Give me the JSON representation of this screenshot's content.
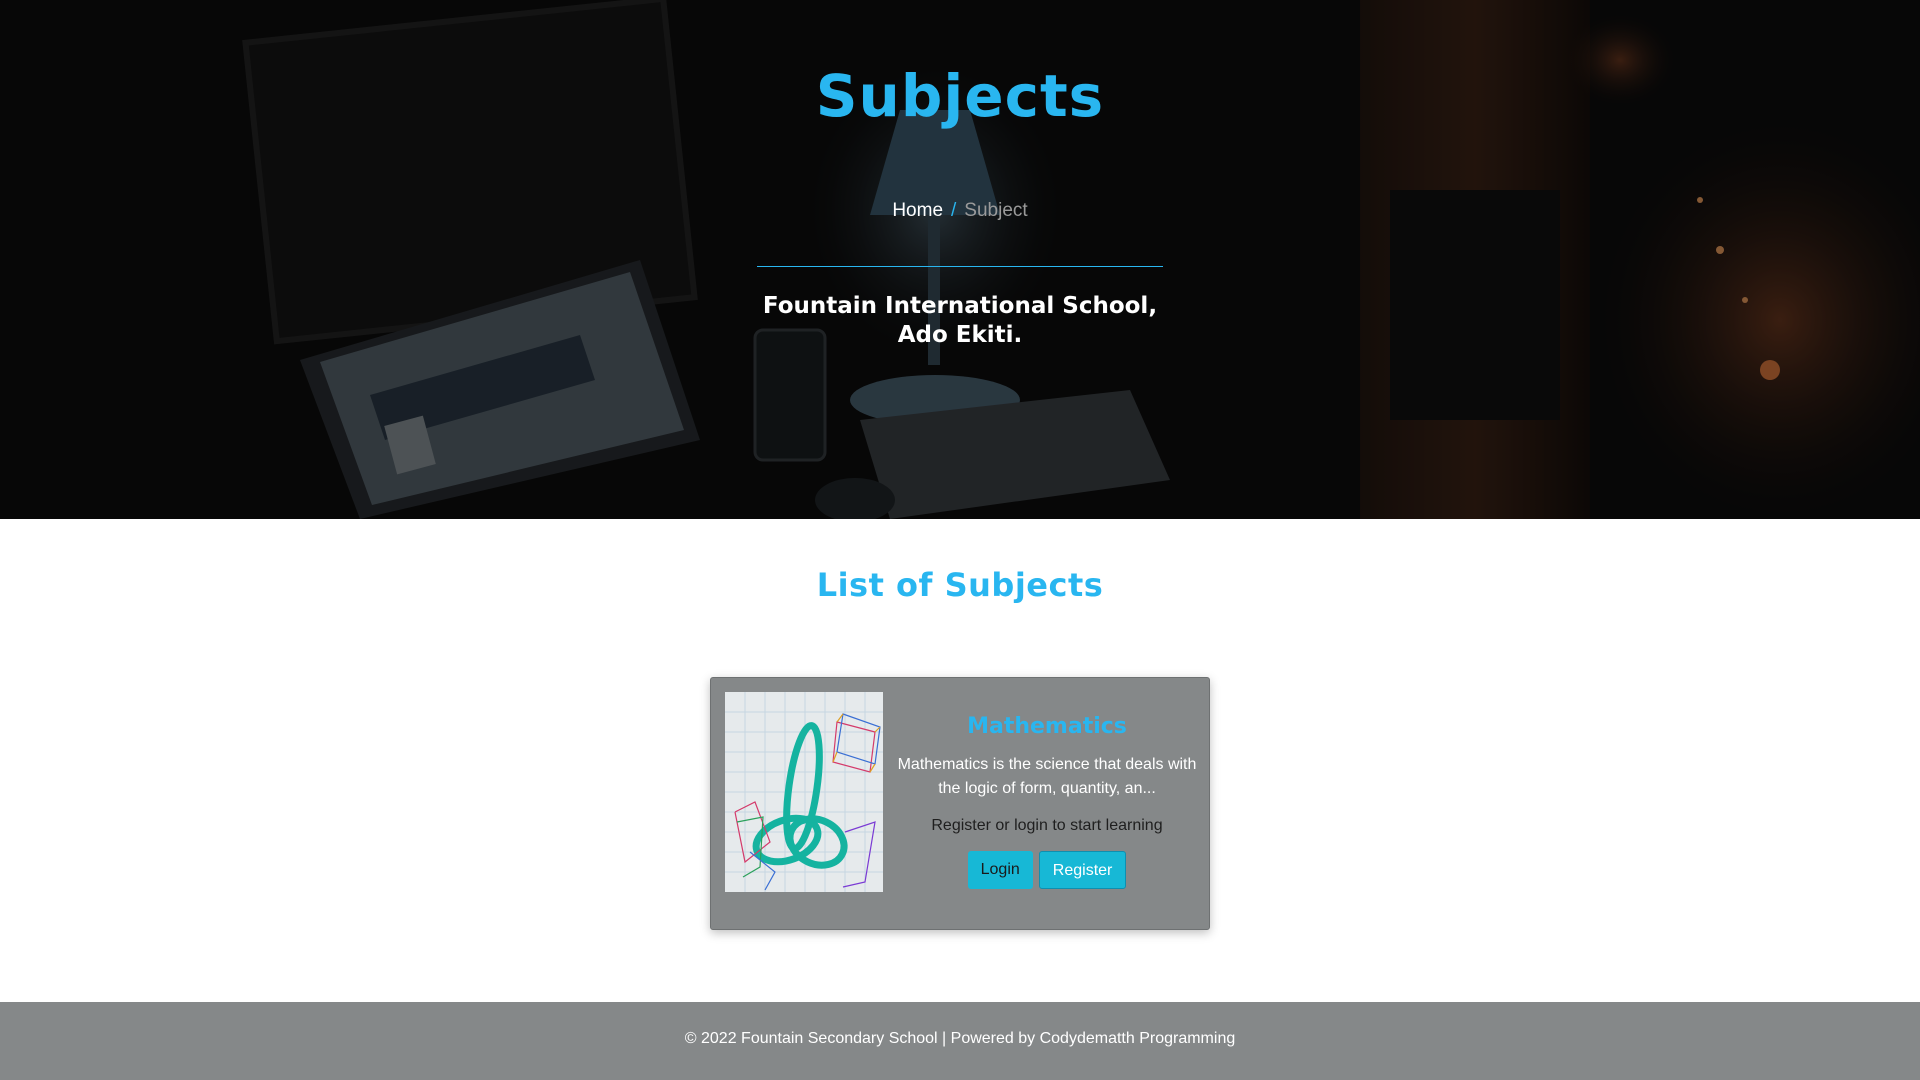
{
  "hero": {
    "title": "Subjects",
    "breadcrumb": {
      "home": "Home",
      "separator": "/",
      "current": "Subject"
    },
    "subtitle_line1": "Fountain International School,",
    "subtitle_line2": "Ado Ekiti."
  },
  "section": {
    "title": "List of Subjects"
  },
  "subjects": [
    {
      "name": "Mathematics",
      "description": "Mathematics is the science that deals with the logic of form, quantity, an...",
      "note": "Register or login to start learning",
      "login_label": "Login",
      "register_label": "Register"
    }
  ],
  "footer": {
    "text": "© 2022 Fountain Secondary School | Powered by Codydematth Programming"
  },
  "colors": {
    "accent": "#29b6f0",
    "button": "#17b8d6",
    "card_bg": "#858889",
    "footer_bg": "#858889"
  }
}
